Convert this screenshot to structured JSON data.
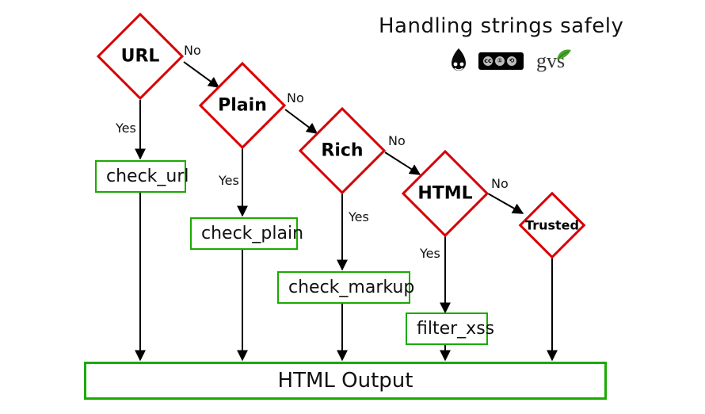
{
  "diagram": {
    "title": "Handling strings safely",
    "decisions": {
      "url": {
        "label": "URL",
        "yes": "Yes",
        "no": "No"
      },
      "plain": {
        "label": "Plain",
        "yes": "Yes",
        "no": "No"
      },
      "rich": {
        "label": "Rich",
        "yes": "Yes",
        "no": "No"
      },
      "html": {
        "label": "HTML",
        "yes": "Yes",
        "no": "No"
      },
      "trusted": {
        "label": "Trusted"
      }
    },
    "processes": {
      "check_url": "check_url",
      "check_plain": "check_plain",
      "check_markup": "check_markup",
      "filter_xss": "filter_xss"
    },
    "output": "HTML Output",
    "attribution": {
      "drupal": "drupal-logo",
      "cc": "cc-by-sa",
      "gvs": "gvs"
    }
  }
}
